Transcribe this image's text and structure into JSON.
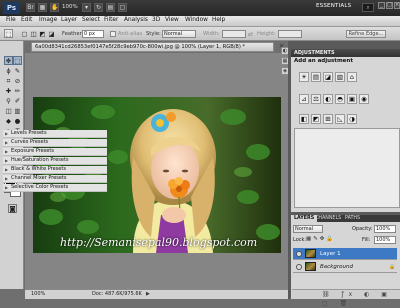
{
  "app": {
    "logo": "Ps",
    "zoom": "100%",
    "workspace": "ESSENTIALS",
    "search_placeholder": "",
    "win_controls": [
      "_",
      "□",
      "×"
    ]
  },
  "menu": [
    "File",
    "Edit",
    "Image",
    "Layer",
    "Select",
    "Filter",
    "Analysis",
    "3D",
    "View",
    "Window",
    "Help"
  ],
  "options": {
    "feather_label": "Feather:",
    "feather_value": "0 px",
    "antialias_label": "Anti-alias",
    "style_label": "Style:",
    "style_value": "Normal",
    "width_label": "Width:",
    "height_label": "Height:",
    "refine_button": "Refine Edge..."
  },
  "document": {
    "tab_title": "6a00d8341cd26853ef0147e5f28c9eb970c-800wi.jpg @ 100% (Layer 1, RGB/8) *",
    "watermark": "http://Semanisepal90.blogspot.com",
    "status_zoom": "100%",
    "status_doc": "Doc: 487.6K/975.6K"
  },
  "adjustments": {
    "panel_title": "ADJUSTMENTS",
    "subtitle": "Add an adjustment",
    "icon_row1": [
      "☀",
      "▤",
      "◪",
      "▧",
      "⌂"
    ],
    "icon_row2": [
      "⊿",
      "⚖",
      "◐",
      "◓",
      "▣",
      "◉"
    ],
    "icon_row3": [
      "◧",
      "◩",
      "⊞",
      "◺",
      "◑"
    ],
    "presets": [
      "Levels Presets",
      "Curves Presets",
      "Exposure Presets",
      "Hue/Saturation Presets",
      "Black & White Presets",
      "Channel Mixer Presets",
      "Selective Color Presets"
    ]
  },
  "layers_panel": {
    "tabs": [
      "LAYERS",
      "CHANNELS",
      "PATHS"
    ],
    "blend_mode": "Normal",
    "opacity_label": "Opacity:",
    "opacity_value": "100%",
    "lock_label": "Lock:",
    "fill_label": "Fill:",
    "fill_value": "100%",
    "layers": [
      "Layer 1",
      "Background"
    ]
  },
  "colors": {
    "accent": "#3d79c5",
    "foreground": "#0a0a0a",
    "background": "#ffffff"
  }
}
